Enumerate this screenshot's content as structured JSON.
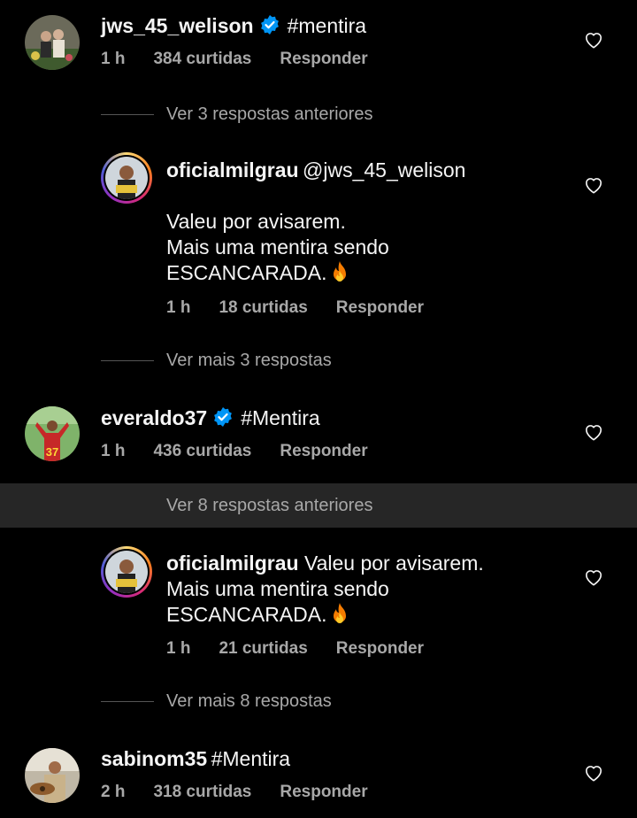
{
  "comments": [
    {
      "username": "jws_45_welison",
      "verified": true,
      "text": "#mentira",
      "time": "1 h",
      "likes": "384 curtidas",
      "reply_label": "Responder",
      "view_replies": "Ver 3 respostas anteriores"
    },
    {
      "username": "everaldo37",
      "verified": true,
      "text": "#Mentira",
      "time": "1 h",
      "likes": "436 curtidas",
      "reply_label": "Responder",
      "view_replies": "Ver 8 respostas anteriores"
    },
    {
      "username": "sabinom35",
      "verified": false,
      "text": "#Mentira",
      "time": "2 h",
      "likes": "318 curtidas",
      "reply_label": "Responder"
    }
  ],
  "replies": [
    {
      "username": "oficialmilgrau",
      "mention": "@jws_45_welison",
      "line1": "Valeu por avisarem.",
      "line2": "Mais uma mentira sendo",
      "line3": "ESCANCARADA.",
      "time": "1 h",
      "likes": "18 curtidas",
      "reply_label": "Responder",
      "view_more": "Ver mais 3 respostas"
    },
    {
      "username": "oficialmilgrau",
      "line1": "Valeu por avisarem.",
      "line2": "Mais uma mentira sendo",
      "line3": "ESCANCARADA.",
      "time": "1 h",
      "likes": "21 curtidas",
      "reply_label": "Responder",
      "view_more": "Ver mais 8 respostas"
    }
  ],
  "colors": {
    "background": "#000000",
    "text": "#f5f5f5",
    "secondary": "#a8a8a8",
    "verified_blue": "#0095f6",
    "highlight_band": "#262626"
  },
  "icons": {
    "like": "heart-outline-icon",
    "verified": "verified-badge-icon",
    "emoji": "fire-emoji-icon"
  }
}
